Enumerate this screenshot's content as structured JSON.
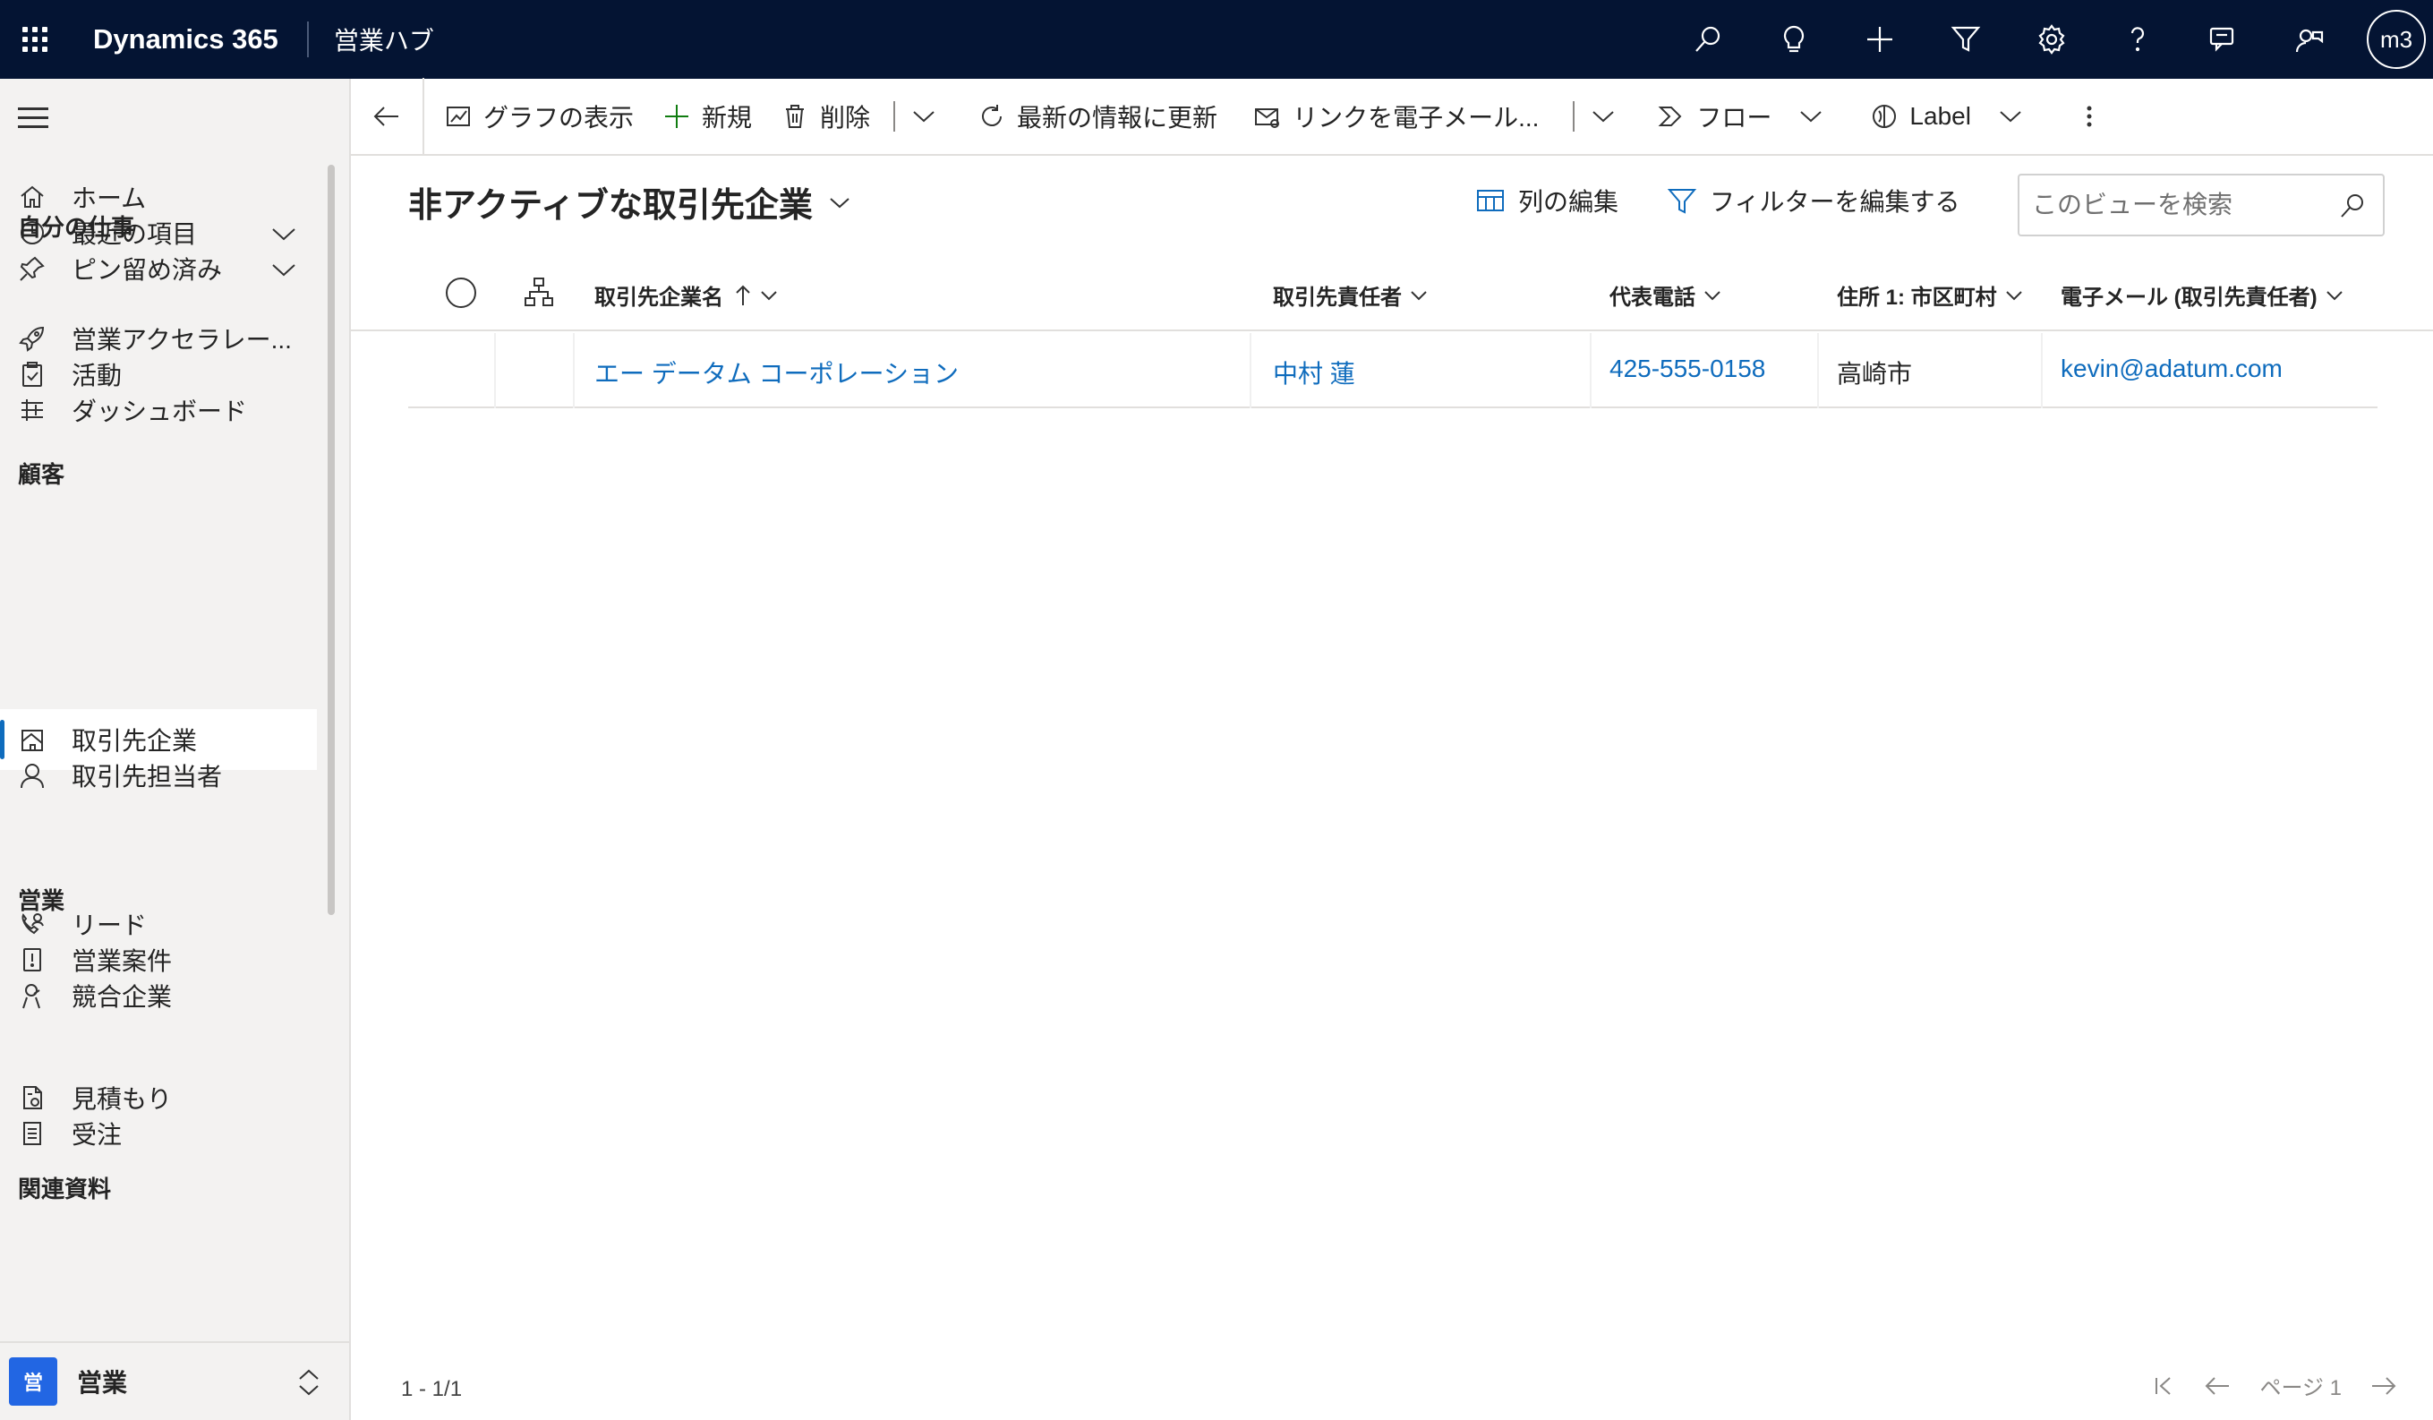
{
  "topbar": {
    "app_name": "Dynamics 365",
    "hub_name": "営業ハブ",
    "avatar_initials": "m3",
    "icons": [
      "search-icon",
      "lightbulb-icon",
      "plus-icon",
      "filter-icon",
      "settings-icon",
      "help-icon",
      "chat-icon",
      "feedback-icon"
    ],
    "background": "#041433"
  },
  "sidebar": {
    "items_top": [
      {
        "label": "ホーム",
        "icon": "home-icon"
      },
      {
        "label": "最近の項目",
        "icon": "clock-icon"
      },
      {
        "label": "ピン留め済み",
        "icon": "pin-icon"
      }
    ],
    "sections": [
      {
        "title": "自分の仕事",
        "items": [
          {
            "label": "営業アクセラレー...",
            "icon": "rocket-icon"
          },
          {
            "label": "活動",
            "icon": "clipboard-icon"
          },
          {
            "label": "ダッシュボード",
            "icon": "dashboard-icon"
          }
        ]
      },
      {
        "title": "顧客",
        "items": [
          {
            "label": "取引先企業",
            "icon": "building-icon",
            "selected": true
          },
          {
            "label": "取引先担当者",
            "icon": "person-icon"
          }
        ]
      },
      {
        "title": "営業",
        "items": [
          {
            "label": "リード",
            "icon": "phone-person-icon"
          },
          {
            "label": "営業案件",
            "icon": "opportunity-icon"
          },
          {
            "label": "競合企業",
            "icon": "competitor-icon"
          }
        ]
      },
      {
        "title": "関連資料",
        "items": [
          {
            "label": "見積もり",
            "icon": "quote-icon"
          },
          {
            "label": "受注",
            "icon": "order-icon"
          }
        ]
      }
    ],
    "area": {
      "badge": "営",
      "label": "営業",
      "badge_color": "#2266e3"
    }
  },
  "commandbar": {
    "show_chart": "グラフの表示",
    "new": "新規",
    "delete": "削除",
    "refresh": "最新の情報に更新",
    "email_link": "リンクを電子メール...",
    "flow": "フロー",
    "label": "Label"
  },
  "view": {
    "title": "非アクティブな取引先企業",
    "edit_columns": "列の編集",
    "edit_filters": "フィルターを編集する",
    "search_placeholder": "このビューを検索"
  },
  "grid": {
    "columns": [
      "取引先企業名",
      "取引先責任者",
      "代表電話",
      "住所 1: 市区町村",
      "電子メール (取引先責任者)"
    ],
    "rows": [
      {
        "name": "エー データム コーポレーション",
        "contact": "中村 蓮",
        "phone": "425-555-0158",
        "city": "高崎市",
        "email": "kevin@adatum.com"
      }
    ],
    "link_color": "#0f6cbd"
  },
  "footer": {
    "count": "1 - 1/1",
    "page": "ページ 1"
  }
}
